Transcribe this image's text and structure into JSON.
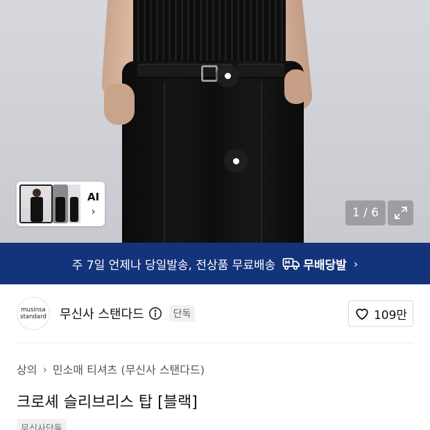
{
  "gallery": {
    "page_current": "1",
    "page_total": "6",
    "page_indicator": "1 / 6",
    "ai_label": "AI",
    "ai_chevron": "›"
  },
  "banner": {
    "text": "주 7일 언제나 당일발송, 전상품 무료배송",
    "brand": "무배당발",
    "chevron": "›",
    "color": "#13337a"
  },
  "brand": {
    "logo_line1": "musinsa",
    "logo_line2": "standard",
    "name": "무신사 스탠다드",
    "tag": "단독",
    "likes": "109만"
  },
  "breadcrumb": {
    "category": "상의",
    "subcategory": "민소매 티셔츠 (무신사 스탠다드)",
    "separator": "›"
  },
  "product": {
    "title": "크로셰 슬리브리스 탑 [블랙]",
    "badge": "무신사단독"
  },
  "icons": {
    "ai": "ai-chevron-icon",
    "expand": "expand-icon",
    "truck": "delivery-truck-icon",
    "info": "info-icon",
    "like": "heart-icon"
  }
}
